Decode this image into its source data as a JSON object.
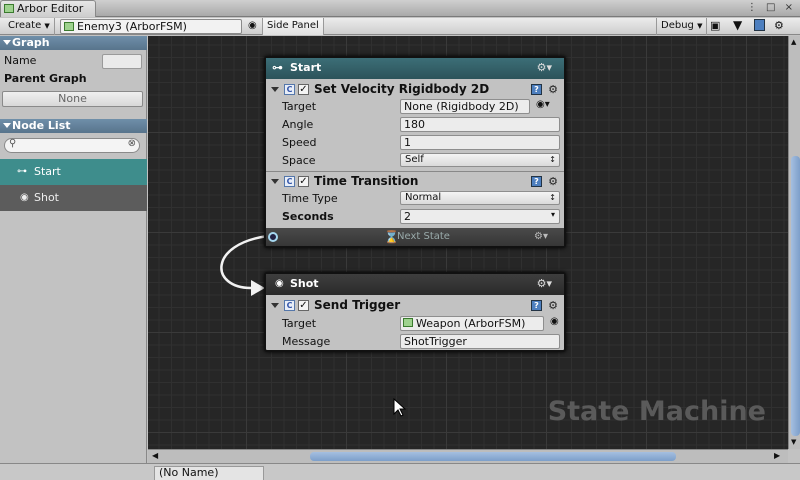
{
  "window": {
    "tab_title": "Arbor Editor",
    "buttons": "⋮ □ ×"
  },
  "toolbar": {
    "create_label": "Create",
    "graph_name": "Enemy3 (ArborFSM)",
    "side_panel_label": "Side Panel",
    "debug_label": "Debug"
  },
  "graph_section": {
    "header": "Graph",
    "name_label": "Name",
    "parent_label": "Parent Graph",
    "parent_value": "None"
  },
  "node_list": {
    "header": "Node List",
    "items": [
      {
        "label": "Start"
      },
      {
        "label": "Shot"
      }
    ]
  },
  "nodes": {
    "start": {
      "title": "Start",
      "behaviours": [
        {
          "title": "Set Velocity Rigidbody 2D",
          "fields": [
            {
              "label": "Target",
              "value": "None (Rigidbody 2D)"
            },
            {
              "label": "Angle",
              "value": "180"
            },
            {
              "label": "Speed",
              "value": "1"
            },
            {
              "label": "Space",
              "value": "Self"
            }
          ]
        },
        {
          "title": "Time Transition",
          "fields": [
            {
              "label": "Time Type",
              "value": "Normal"
            },
            {
              "label": "Seconds",
              "value": "2"
            }
          ]
        }
      ],
      "transition": "Next State"
    },
    "shot": {
      "title": "Shot",
      "behaviours": [
        {
          "title": "Send Trigger",
          "fields": [
            {
              "label": "Target",
              "value": "Weapon (ArborFSM)"
            },
            {
              "label": "Message",
              "value": "ShotTrigger"
            }
          ]
        }
      ]
    }
  },
  "watermark": "State Machine",
  "status": {
    "name": "(No Name)"
  },
  "colors": {
    "state_header": "#3c6e77",
    "selected_item": "#3e8d8c",
    "section_header": "#6f8fa9",
    "canvas": "#262626"
  }
}
